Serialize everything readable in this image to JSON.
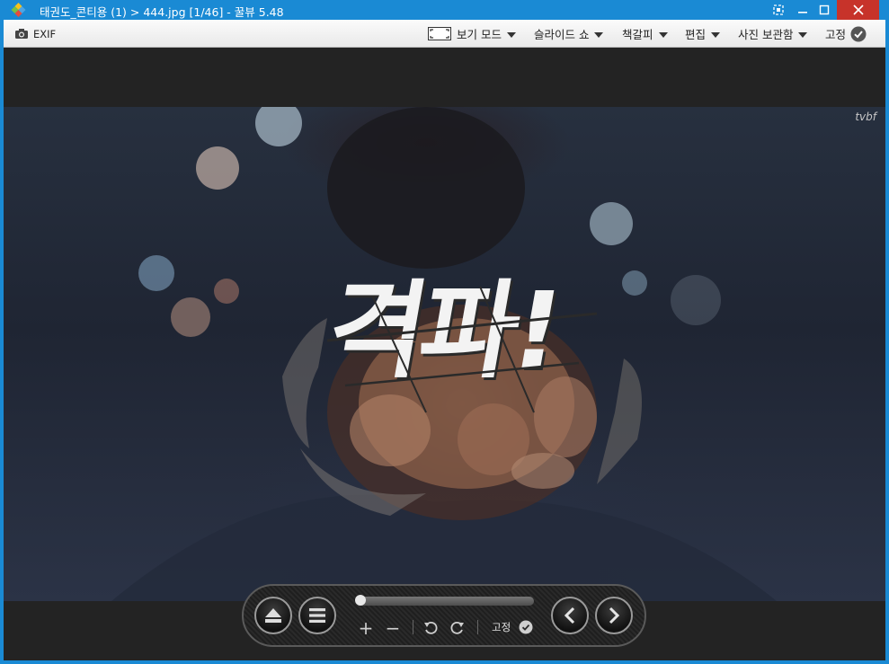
{
  "window": {
    "title": "태권도_콘티용 (1) > 444.jpg [1/46] - 꿀뷰 5.48"
  },
  "toolbar": {
    "exif_label": "EXIF",
    "view_mode_label": "보기 모드",
    "slideshow_label": "슬라이드 쇼",
    "bookmark_label": "책갈피",
    "edit_label": "편집",
    "photo_box_label": "사진 보관함",
    "pin_label": "고정"
  },
  "photo": {
    "watermark": "tvbf",
    "overlay_text": "격파!"
  },
  "controls": {
    "pin_label": "고정",
    "zoom_in_glyph": "+",
    "zoom_out_glyph": "−"
  },
  "colors": {
    "titlebar": "#1a8ad4",
    "close_button": "#c7332a",
    "viewer_bg": "#232323"
  }
}
